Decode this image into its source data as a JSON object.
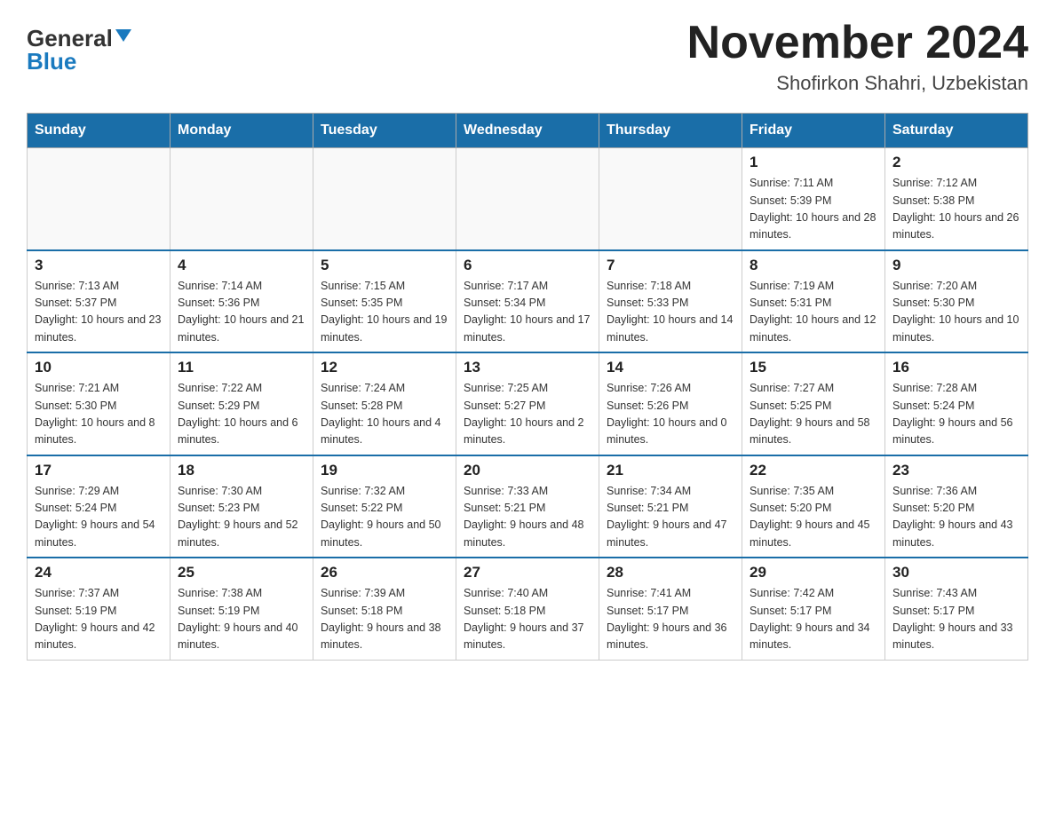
{
  "logo": {
    "general": "General",
    "blue": "Blue"
  },
  "title": {
    "month": "November 2024",
    "location": "Shofirkon Shahri, Uzbekistan"
  },
  "weekdays": [
    "Sunday",
    "Monday",
    "Tuesday",
    "Wednesday",
    "Thursday",
    "Friday",
    "Saturday"
  ],
  "weeks": [
    [
      {
        "day": "",
        "info": ""
      },
      {
        "day": "",
        "info": ""
      },
      {
        "day": "",
        "info": ""
      },
      {
        "day": "",
        "info": ""
      },
      {
        "day": "",
        "info": ""
      },
      {
        "day": "1",
        "info": "Sunrise: 7:11 AM\nSunset: 5:39 PM\nDaylight: 10 hours and 28 minutes."
      },
      {
        "day": "2",
        "info": "Sunrise: 7:12 AM\nSunset: 5:38 PM\nDaylight: 10 hours and 26 minutes."
      }
    ],
    [
      {
        "day": "3",
        "info": "Sunrise: 7:13 AM\nSunset: 5:37 PM\nDaylight: 10 hours and 23 minutes."
      },
      {
        "day": "4",
        "info": "Sunrise: 7:14 AM\nSunset: 5:36 PM\nDaylight: 10 hours and 21 minutes."
      },
      {
        "day": "5",
        "info": "Sunrise: 7:15 AM\nSunset: 5:35 PM\nDaylight: 10 hours and 19 minutes."
      },
      {
        "day": "6",
        "info": "Sunrise: 7:17 AM\nSunset: 5:34 PM\nDaylight: 10 hours and 17 minutes."
      },
      {
        "day": "7",
        "info": "Sunrise: 7:18 AM\nSunset: 5:33 PM\nDaylight: 10 hours and 14 minutes."
      },
      {
        "day": "8",
        "info": "Sunrise: 7:19 AM\nSunset: 5:31 PM\nDaylight: 10 hours and 12 minutes."
      },
      {
        "day": "9",
        "info": "Sunrise: 7:20 AM\nSunset: 5:30 PM\nDaylight: 10 hours and 10 minutes."
      }
    ],
    [
      {
        "day": "10",
        "info": "Sunrise: 7:21 AM\nSunset: 5:30 PM\nDaylight: 10 hours and 8 minutes."
      },
      {
        "day": "11",
        "info": "Sunrise: 7:22 AM\nSunset: 5:29 PM\nDaylight: 10 hours and 6 minutes."
      },
      {
        "day": "12",
        "info": "Sunrise: 7:24 AM\nSunset: 5:28 PM\nDaylight: 10 hours and 4 minutes."
      },
      {
        "day": "13",
        "info": "Sunrise: 7:25 AM\nSunset: 5:27 PM\nDaylight: 10 hours and 2 minutes."
      },
      {
        "day": "14",
        "info": "Sunrise: 7:26 AM\nSunset: 5:26 PM\nDaylight: 10 hours and 0 minutes."
      },
      {
        "day": "15",
        "info": "Sunrise: 7:27 AM\nSunset: 5:25 PM\nDaylight: 9 hours and 58 minutes."
      },
      {
        "day": "16",
        "info": "Sunrise: 7:28 AM\nSunset: 5:24 PM\nDaylight: 9 hours and 56 minutes."
      }
    ],
    [
      {
        "day": "17",
        "info": "Sunrise: 7:29 AM\nSunset: 5:24 PM\nDaylight: 9 hours and 54 minutes."
      },
      {
        "day": "18",
        "info": "Sunrise: 7:30 AM\nSunset: 5:23 PM\nDaylight: 9 hours and 52 minutes."
      },
      {
        "day": "19",
        "info": "Sunrise: 7:32 AM\nSunset: 5:22 PM\nDaylight: 9 hours and 50 minutes."
      },
      {
        "day": "20",
        "info": "Sunrise: 7:33 AM\nSunset: 5:21 PM\nDaylight: 9 hours and 48 minutes."
      },
      {
        "day": "21",
        "info": "Sunrise: 7:34 AM\nSunset: 5:21 PM\nDaylight: 9 hours and 47 minutes."
      },
      {
        "day": "22",
        "info": "Sunrise: 7:35 AM\nSunset: 5:20 PM\nDaylight: 9 hours and 45 minutes."
      },
      {
        "day": "23",
        "info": "Sunrise: 7:36 AM\nSunset: 5:20 PM\nDaylight: 9 hours and 43 minutes."
      }
    ],
    [
      {
        "day": "24",
        "info": "Sunrise: 7:37 AM\nSunset: 5:19 PM\nDaylight: 9 hours and 42 minutes."
      },
      {
        "day": "25",
        "info": "Sunrise: 7:38 AM\nSunset: 5:19 PM\nDaylight: 9 hours and 40 minutes."
      },
      {
        "day": "26",
        "info": "Sunrise: 7:39 AM\nSunset: 5:18 PM\nDaylight: 9 hours and 38 minutes."
      },
      {
        "day": "27",
        "info": "Sunrise: 7:40 AM\nSunset: 5:18 PM\nDaylight: 9 hours and 37 minutes."
      },
      {
        "day": "28",
        "info": "Sunrise: 7:41 AM\nSunset: 5:17 PM\nDaylight: 9 hours and 36 minutes."
      },
      {
        "day": "29",
        "info": "Sunrise: 7:42 AM\nSunset: 5:17 PM\nDaylight: 9 hours and 34 minutes."
      },
      {
        "day": "30",
        "info": "Sunrise: 7:43 AM\nSunset: 5:17 PM\nDaylight: 9 hours and 33 minutes."
      }
    ]
  ]
}
